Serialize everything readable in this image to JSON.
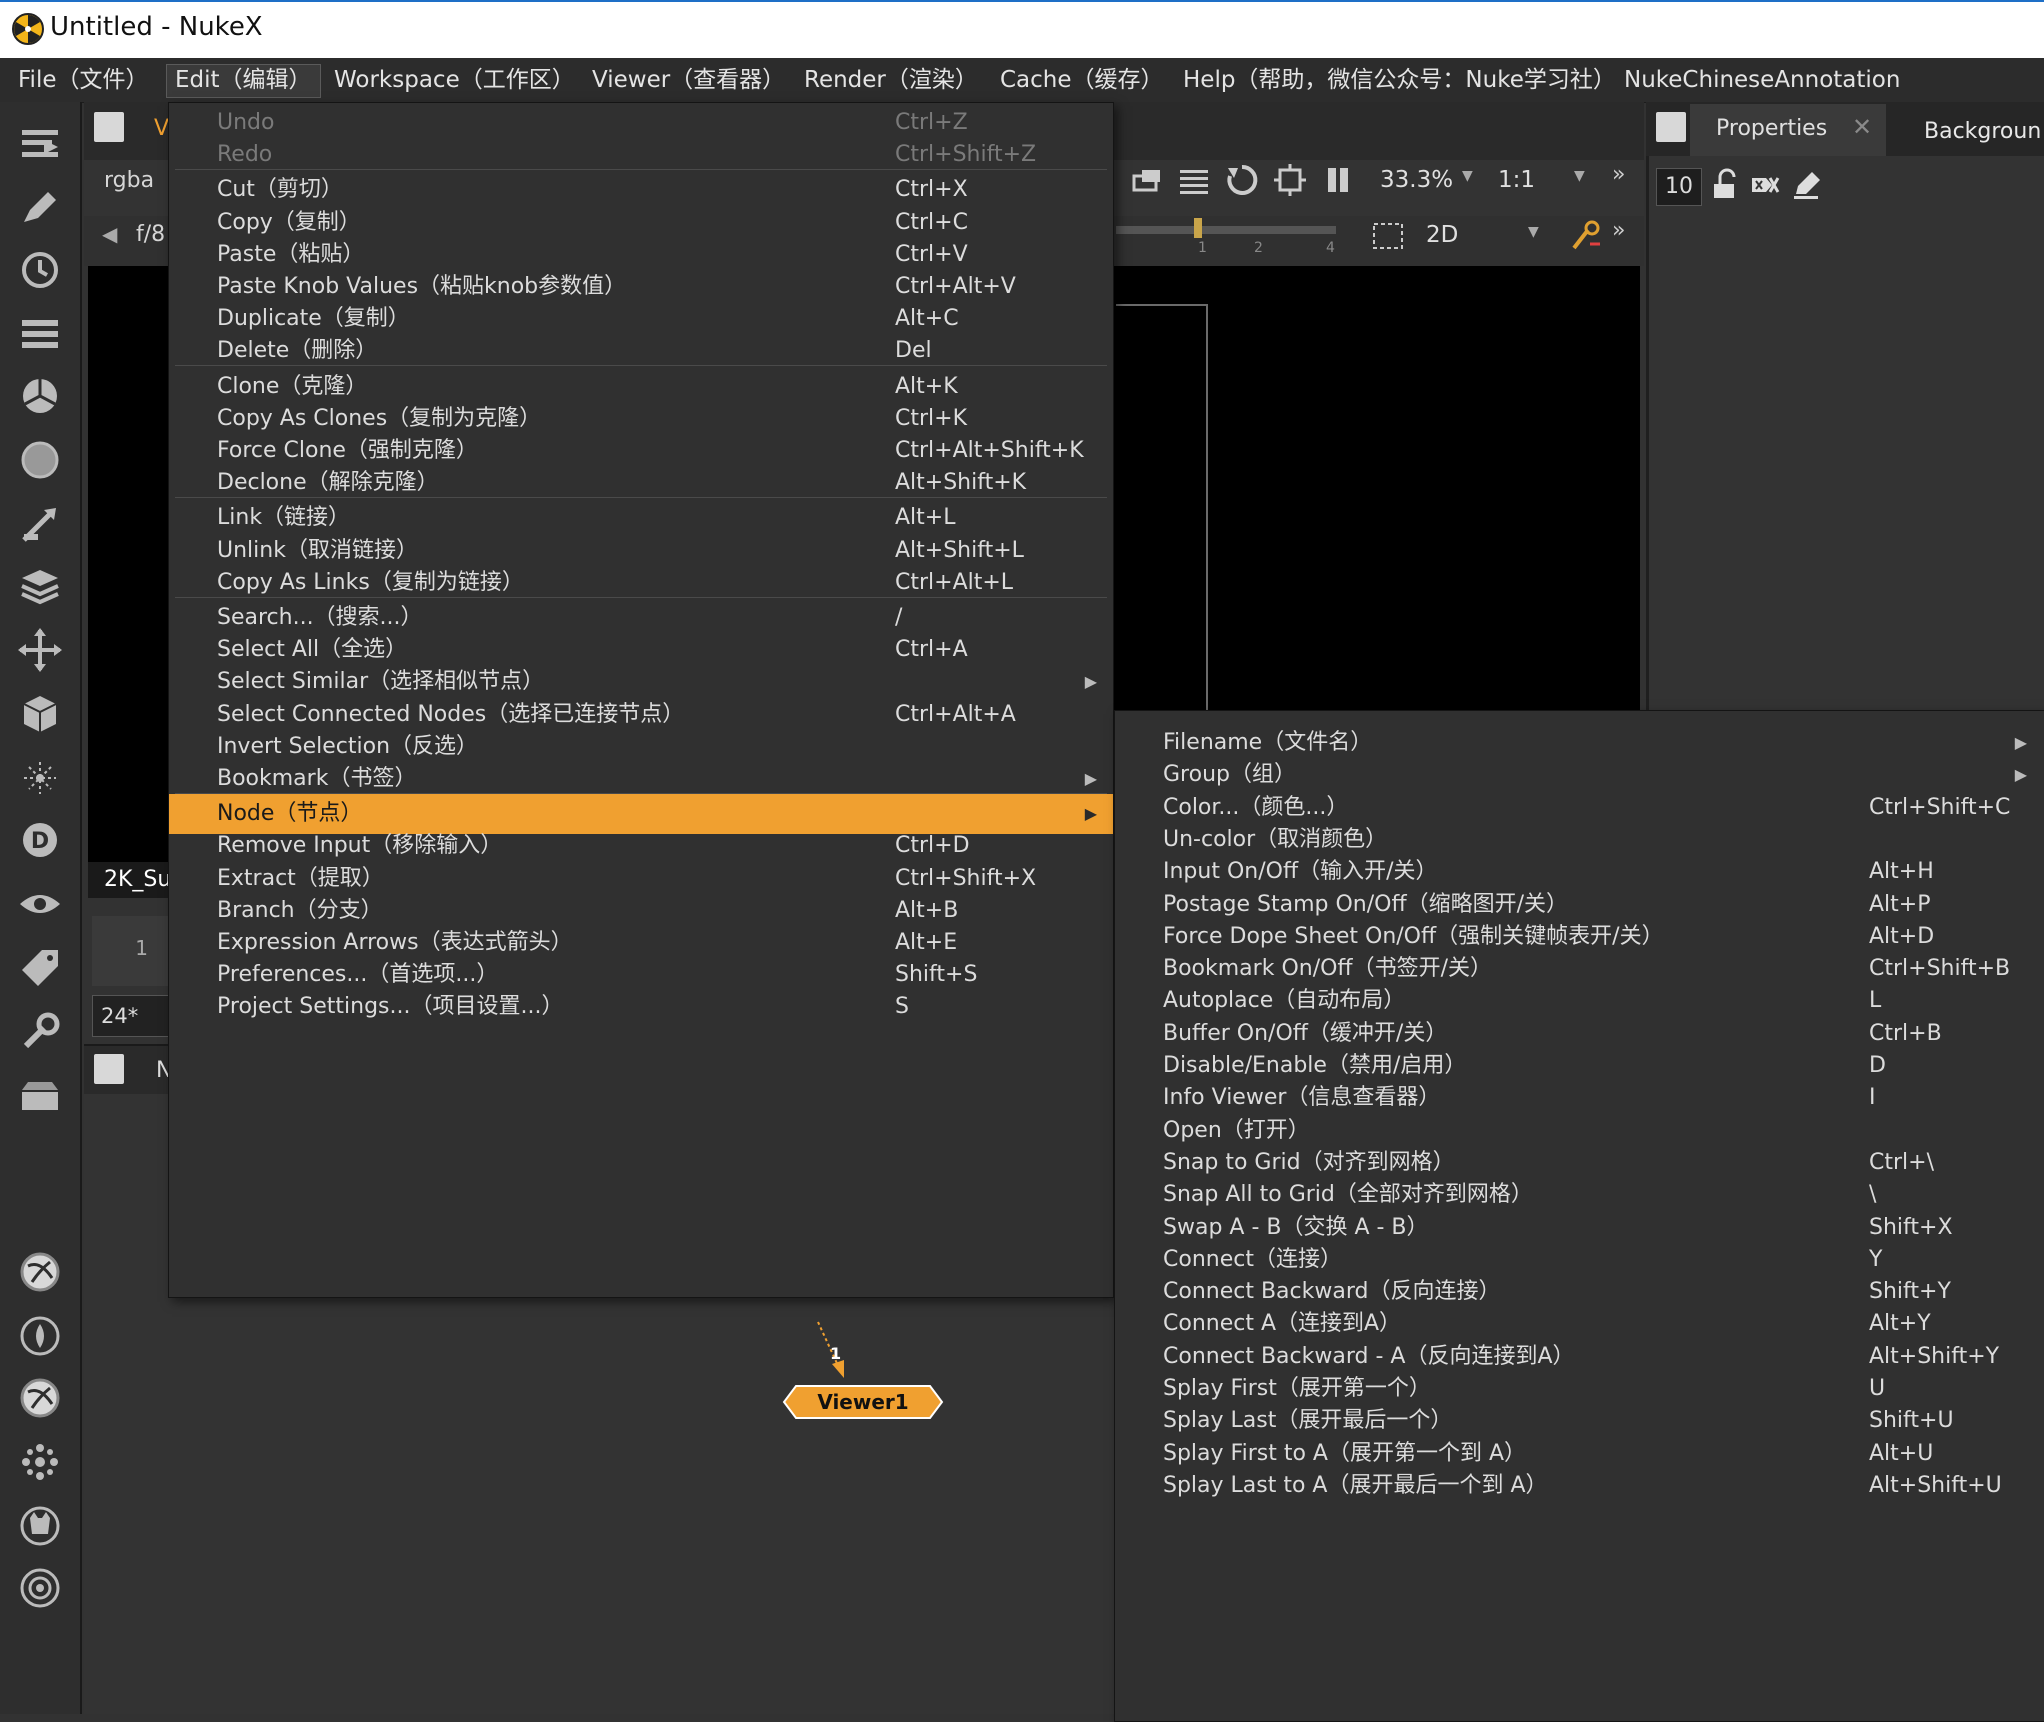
{
  "window": {
    "title": "Untitled - NukeX"
  },
  "menubar": {
    "items": [
      "File（文件）",
      "Edit（编辑）",
      "Workspace（工作区）",
      "Viewer（查看器）",
      "Render（渲染）",
      "Cache（缓存）",
      "Help（帮助，微信公众号：Nuke学习社）",
      "NukeChineseAnnotation"
    ]
  },
  "viewer": {
    "tab_partial": "V",
    "channels": "rgba",
    "fstop": "f/8",
    "zoom": "33.3%",
    "ratio": "1:1",
    "view_mode": "2D",
    "format": "2K_Su",
    "frame": "1",
    "fps": "24*",
    "ticks": [
      "1",
      "2",
      "4"
    ],
    "dag_tab_partial": "N"
  },
  "properties": {
    "tab_label": "Properties",
    "second_tab": "Backgroun",
    "max_panels": "10"
  },
  "edit_menu": {
    "items": [
      {
        "label": "Undo",
        "shortcut": "Ctrl+Z",
        "disabled": true
      },
      {
        "label": "Redo",
        "shortcut": "Ctrl+Shift+Z",
        "disabled": true
      },
      {
        "label": "Cut（剪切）",
        "shortcut": "Ctrl+X"
      },
      {
        "label": "Copy（复制）",
        "shortcut": "Ctrl+C"
      },
      {
        "label": "Paste（粘贴）",
        "shortcut": "Ctrl+V"
      },
      {
        "label": "Paste Knob Values（粘贴knob参数值）",
        "shortcut": "Ctrl+Alt+V"
      },
      {
        "label": "Duplicate（复制）",
        "shortcut": "Alt+C"
      },
      {
        "label": "Delete（删除）",
        "shortcut": "Del"
      },
      {
        "label": "Clone（克隆）",
        "shortcut": "Alt+K"
      },
      {
        "label": "Copy As Clones（复制为克隆）",
        "shortcut": "Ctrl+K"
      },
      {
        "label": "Force Clone（强制克隆）",
        "shortcut": "Ctrl+Alt+Shift+K"
      },
      {
        "label": "Declone（解除克隆）",
        "shortcut": "Alt+Shift+K"
      },
      {
        "label": "Link（链接）",
        "shortcut": "Alt+L"
      },
      {
        "label": "Unlink（取消链接）",
        "shortcut": "Alt+Shift+L"
      },
      {
        "label": "Copy As Links（复制为链接）",
        "shortcut": "Ctrl+Alt+L"
      },
      {
        "label": "Search...（搜索...）",
        "shortcut": "/"
      },
      {
        "label": "Select All（全选）",
        "shortcut": "Ctrl+A"
      },
      {
        "label": "Select Similar（选择相似节点）",
        "shortcut": "",
        "submenu": true
      },
      {
        "label": "Select Connected Nodes（选择已连接节点）",
        "shortcut": "Ctrl+Alt+A"
      },
      {
        "label": "Invert Selection（反选）",
        "shortcut": ""
      },
      {
        "label": "Bookmark（书签）",
        "shortcut": "",
        "submenu": true
      },
      {
        "label": "Node（节点）",
        "shortcut": "",
        "submenu": true,
        "highlight": true
      },
      {
        "label": "Remove Input（移除输入）",
        "shortcut": "Ctrl+D"
      },
      {
        "label": "Extract（提取）",
        "shortcut": "Ctrl+Shift+X"
      },
      {
        "label": "Branch（分支）",
        "shortcut": "Alt+B"
      },
      {
        "label": "Expression Arrows（表达式箭头）",
        "shortcut": "Alt+E"
      },
      {
        "label": "Preferences...（首选项...）",
        "shortcut": "Shift+S"
      },
      {
        "label": "Project Settings...（项目设置...）",
        "shortcut": "S"
      }
    ]
  },
  "node_menu": {
    "items": [
      {
        "label": "Filename（文件名）",
        "shortcut": "",
        "submenu": true
      },
      {
        "label": "Group（组）",
        "shortcut": "",
        "submenu": true
      },
      {
        "label": "Color...（颜色...）",
        "shortcut": "Ctrl+Shift+C"
      },
      {
        "label": "Un-color（取消颜色）",
        "shortcut": ""
      },
      {
        "label": "Input On/Off（输入开/关）",
        "shortcut": "Alt+H"
      },
      {
        "label": "Postage Stamp On/Off（缩略图开/关）",
        "shortcut": "Alt+P"
      },
      {
        "label": "Force Dope Sheet On/Off（强制关键帧表开/关）",
        "shortcut": "Alt+D"
      },
      {
        "label": "Bookmark On/Off（书签开/关）",
        "shortcut": "Ctrl+Shift+B"
      },
      {
        "label": "Autoplace（自动布局）",
        "shortcut": "L"
      },
      {
        "label": "Buffer On/Off（缓冲开/关）",
        "shortcut": "Ctrl+B"
      },
      {
        "label": "Disable/Enable（禁用/启用）",
        "shortcut": "D"
      },
      {
        "label": "Info Viewer（信息查看器）",
        "shortcut": "I"
      },
      {
        "label": "Open（打开）",
        "shortcut": ""
      },
      {
        "label": "Snap to Grid（对齐到网格）",
        "shortcut": "Ctrl+\\"
      },
      {
        "label": "Snap All to Grid（全部对齐到网格）",
        "shortcut": "\\"
      },
      {
        "label": "Swap A - B（交换 A - B）",
        "shortcut": "Shift+X"
      },
      {
        "label": "Connect（连接）",
        "shortcut": "Y"
      },
      {
        "label": "Connect Backward（反向连接）",
        "shortcut": "Shift+Y"
      },
      {
        "label": "Connect A（连接到A）",
        "shortcut": "Alt+Y"
      },
      {
        "label": "Connect Backward - A（反向连接到A）",
        "shortcut": "Alt+Shift+Y"
      },
      {
        "label": "Splay First（展开第一个）",
        "shortcut": "U"
      },
      {
        "label": "Splay Last（展开最后一个）",
        "shortcut": "Shift+U"
      },
      {
        "label": "Splay First to A（展开第一个到 A）",
        "shortcut": "Alt+U"
      },
      {
        "label": "Splay Last to A（展开最后一个到 A）",
        "shortcut": "Alt+Shift+U"
      }
    ]
  },
  "dag": {
    "node_name": "Viewer1",
    "input_number": "1",
    "node_color": "#f0a030"
  },
  "colors": {
    "accent": "#f0a030",
    "menu_bg": "#303030",
    "viewer_bg": "#000000"
  },
  "toolbar_icons": [
    "image-icon",
    "draw-icon",
    "time-icon",
    "channel-icon",
    "color-icon",
    "filter-icon",
    "keyer-icon",
    "merge-icon",
    "transform-icon",
    "3d-icon",
    "particles-icon",
    "deep-icon",
    "views-icon",
    "metadata-icon",
    "toolsets-icon",
    "other-icon",
    "furnace-icon",
    "nuke-tools-icon",
    "ocula-icon",
    "nuke-more-icon",
    "cara-icon",
    "cattery-icon"
  ]
}
